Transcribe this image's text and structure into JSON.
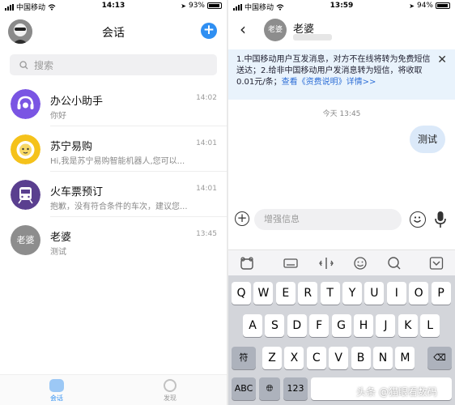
{
  "left": {
    "status": {
      "carrier": "中国移动",
      "time": "14:13",
      "battery": "93%",
      "battery_level": 0.93
    },
    "header": {
      "title": "会话"
    },
    "search": {
      "placeholder": "搜索"
    },
    "conversations": [
      {
        "name": "办公小助手",
        "preview": "你好",
        "time": "14:02",
        "avatar_icon": "headset-icon",
        "avatar_color": "#7a55e3"
      },
      {
        "name": "苏宁易购",
        "preview": "Hi,我是苏宁易购智能机器人,您可以...",
        "time": "14:01",
        "avatar_icon": "lion-icon",
        "avatar_color": "#f5c21b"
      },
      {
        "name": "火车票预订",
        "preview": "抱歉，没有符合条件的车次，建议您...",
        "time": "14:01",
        "avatar_icon": "train-icon",
        "avatar_color": "#5a3f8f"
      },
      {
        "name": "老婆",
        "preview": "测试",
        "time": "13:45",
        "avatar_text": "老婆",
        "avatar_color": "#8d8d8d"
      }
    ],
    "tabs": [
      {
        "label": "会话",
        "icon": "chat-icon",
        "color": "#2f8ff2"
      },
      {
        "label": "发现",
        "icon": "compass-icon",
        "color": "#9a9a9a"
      }
    ]
  },
  "right": {
    "status": {
      "carrier": "中国移动",
      "time": "13:59",
      "battery": "94%",
      "battery_level": 0.94
    },
    "header": {
      "avatar_text": "老婆",
      "name": "老婆"
    },
    "notice": {
      "text": "1.中国移动用户互发消息，对方不在线将转为免费短信送达；2.给非中国移动用户发消息转为短信，将收取0.01元/条；",
      "link": "查看《资费说明》详情>>"
    },
    "day_time": "今天 13:45",
    "message": "测试",
    "input_placeholder": "增强信息",
    "keyboard": {
      "row1": [
        "Q",
        "W",
        "E",
        "R",
        "T",
        "Y",
        "U",
        "I",
        "O",
        "P"
      ],
      "row2": [
        "A",
        "S",
        "D",
        "F",
        "G",
        "H",
        "J",
        "K",
        "L"
      ],
      "row3_left": "符",
      "row3": [
        "Z",
        "X",
        "C",
        "V",
        "B",
        "N",
        "M"
      ],
      "row4_abc": "ABC",
      "row4_num": "123"
    },
    "watermark": "头条 @猫眼看数码"
  }
}
